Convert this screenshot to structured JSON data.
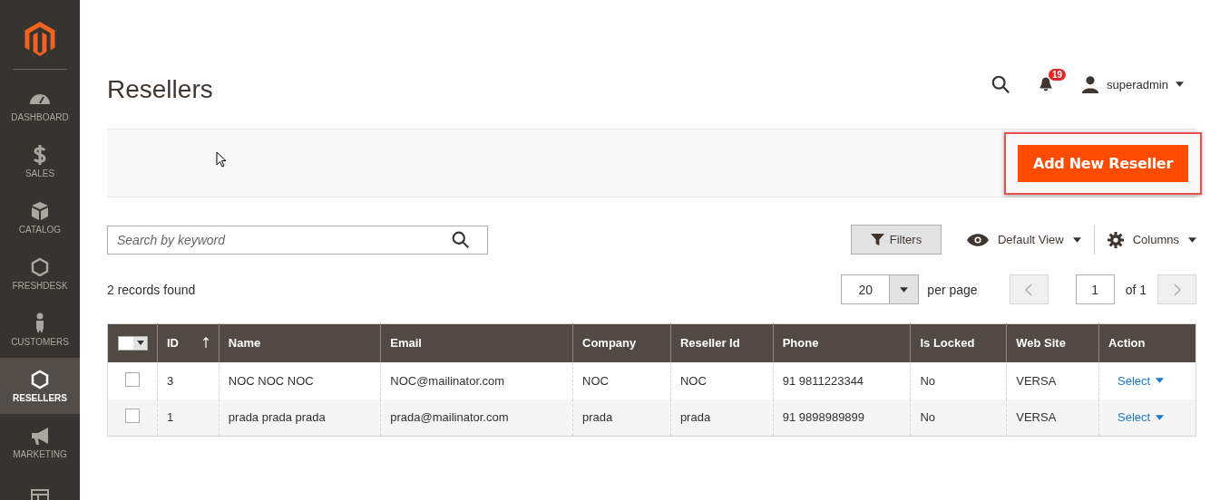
{
  "sidebar": {
    "items": [
      {
        "label": "DASHBOARD",
        "selected": false
      },
      {
        "label": "SALES",
        "selected": false
      },
      {
        "label": "CATALOG",
        "selected": false
      },
      {
        "label": "FRESHDESK",
        "selected": false
      },
      {
        "label": "CUSTOMERS",
        "selected": false
      },
      {
        "label": "RESELLERS",
        "selected": true
      },
      {
        "label": "MARKETING",
        "selected": false
      },
      {
        "selected": false
      }
    ]
  },
  "page_title": "Resellers",
  "header": {
    "notifications": "19",
    "user": "superadmin"
  },
  "add_button": "Add New Reseller",
  "search": {
    "placeholder": "Search by keyword"
  },
  "toolbar": {
    "filters": "Filters",
    "view": "Default View",
    "columns": "Columns"
  },
  "records": "2 records found",
  "pager": {
    "per_page_value": "20",
    "per_page": "per page",
    "page": "1",
    "of": "of 1"
  },
  "table": {
    "mass_select": {
      "checked": false
    },
    "columns": [
      "ID",
      "Name",
      "Email",
      "Company",
      "Reseller Id",
      "Phone",
      "Is Locked",
      "Web Site",
      "Action"
    ],
    "rows": [
      {
        "checked": false,
        "cells": [
          "3",
          "NOC NOC NOC",
          "NOC@mailinator.com",
          "NOC",
          "NOC",
          "91 9811223344",
          "No",
          "VERSA"
        ],
        "action": "Select"
      },
      {
        "checked": false,
        "cells": [
          "1",
          "prada prada prada",
          "prada@mailinator.com",
          "prada",
          "prada",
          "91 9898989899",
          "No",
          "VERSA"
        ],
        "action": "Select"
      }
    ]
  }
}
